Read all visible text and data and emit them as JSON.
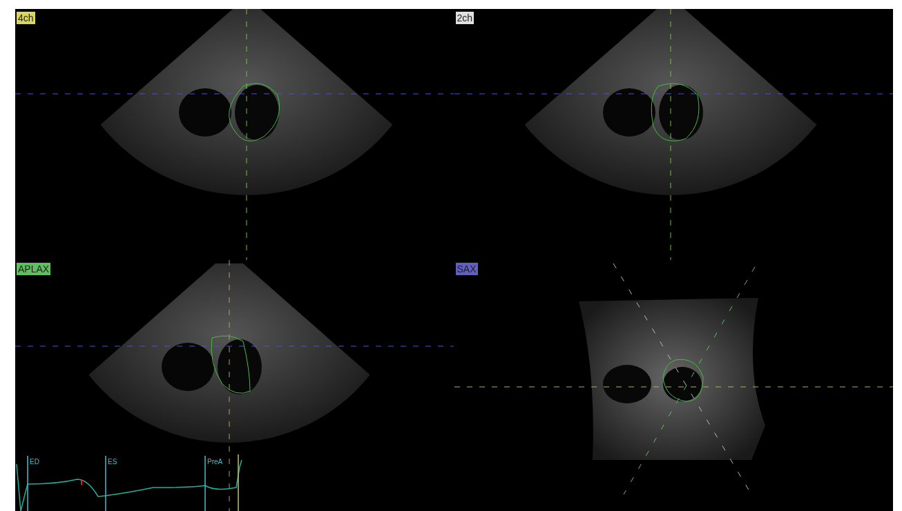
{
  "views": [
    {
      "label": "4ch",
      "color": "#d8d860",
      "kind": "fan"
    },
    {
      "label": "2ch",
      "color": "#e0e0e0",
      "kind": "fan"
    },
    {
      "label": "APLAX",
      "color": "#60c060",
      "kind": "fan"
    },
    {
      "label": "SAX",
      "color": "#6060c0",
      "kind": "sax"
    }
  ],
  "ecg": {
    "markers": [
      {
        "label": "ED"
      },
      {
        "label": "ES"
      },
      {
        "label": "PreA"
      }
    ]
  }
}
